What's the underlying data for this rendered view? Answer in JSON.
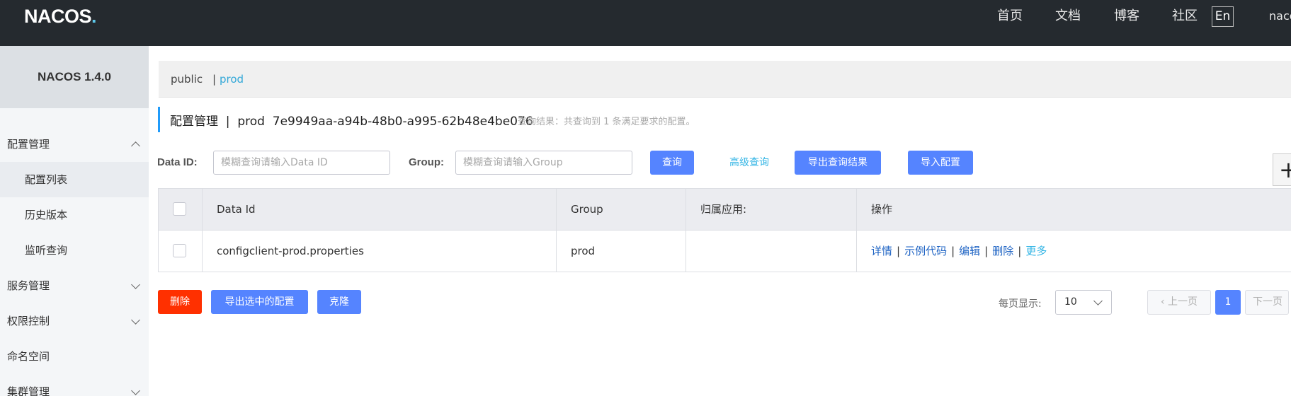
{
  "header": {
    "logo_main": "NACOS",
    "logo_dot": ".",
    "nav": [
      "首页",
      "文档",
      "博客",
      "社区"
    ],
    "lang_button": "En",
    "user": "nacos"
  },
  "sidebar": {
    "brand": "NACOS 1.4.0",
    "items": [
      {
        "label": "配置管理"
      },
      {
        "label": "配置列表"
      },
      {
        "label": "历史版本"
      },
      {
        "label": "监听查询"
      },
      {
        "label": "服务管理"
      },
      {
        "label": "权限控制"
      },
      {
        "label": "命名空间"
      },
      {
        "label": "集群管理"
      }
    ]
  },
  "namespace_bar": {
    "public": "public",
    "separator": "|",
    "current": "prod"
  },
  "page": {
    "title": "配置管理  |  prod  7e9949aa-a94b-48b0-a995-62b48e4be076",
    "result_hint": "查询结果：共查询到 1 条满足要求的配置。"
  },
  "filters": {
    "data_id_label": "Data ID:",
    "data_id_placeholder": "模糊查询请输入Data ID",
    "group_label": "Group:",
    "group_placeholder": "模糊查询请输入Group",
    "query_button": "查询",
    "advanced_link": "高级查询",
    "export_results_button": "导出查询结果",
    "import_button": "导入配置",
    "add_icon_glyph": "+"
  },
  "table": {
    "columns": [
      "Data Id",
      "Group",
      "归属应用:",
      "操作"
    ],
    "rows": [
      {
        "data_id": "configclient-prod.properties",
        "group": "prod",
        "app": ""
      }
    ],
    "actions": [
      "详情",
      "示例代码",
      "编辑",
      "删除",
      "更多"
    ],
    "action_separator": "|"
  },
  "bottom": {
    "delete_button": "删除",
    "export_selected_button": "导出选中的配置",
    "clone_button": "克隆",
    "page_size_label": "每页显示:",
    "page_size_value": "10",
    "prev_button": "上一页",
    "current_page": "1",
    "next_button": "下一页"
  },
  "colors": {
    "header_bg": "#252a2f",
    "primary": "#5584ff",
    "danger": "#ff3000",
    "link": "#33b5e5"
  }
}
